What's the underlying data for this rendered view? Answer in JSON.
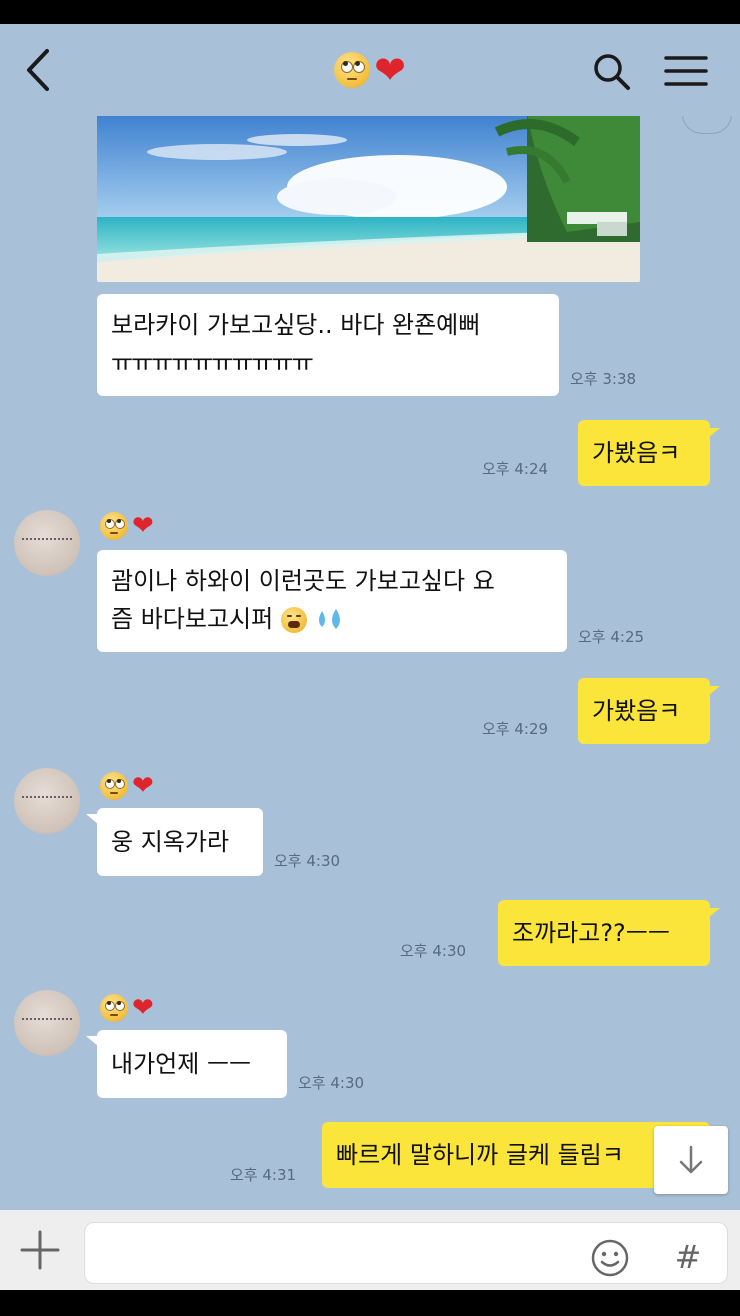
{
  "header": {
    "title_emoji": "eye-roll-face",
    "title_heart": "❤",
    "back_icon": "chevron-left-icon",
    "search_icon": "search-icon",
    "menu_icon": "hamburger-menu-icon"
  },
  "messages": [
    {
      "side": "in",
      "lines": [
        "보라카이 가보고싶당.. 바다 완죤예뻐",
        "ㅠㅠㅠㅠㅠㅠㅠㅠㅠㅠ"
      ],
      "time": "오후 3:38"
    },
    {
      "side": "out",
      "text": "가봤음ㅋ",
      "time": "오후 4:24"
    },
    {
      "side": "in",
      "lines": [
        "괌이나 하와이 이런곳도 가보고싶다 요",
        "즘 바다보고시퍼"
      ],
      "time": "오후 4:25"
    },
    {
      "side": "out",
      "text": "가봤음ㅋ",
      "time": "오후 4:29"
    },
    {
      "side": "in",
      "text": "웅 지옥가라",
      "time": "오후 4:30"
    },
    {
      "side": "out",
      "text": "조까라고??ㅡㅡ",
      "time": "오후 4:30"
    },
    {
      "side": "in",
      "text": "내가언제 ㅡㅡ",
      "time": "오후 4:30"
    },
    {
      "side": "out",
      "text": "빠르게 말하니까 글케 들림ㅋ",
      "time": "오후 4:31"
    }
  ],
  "colors": {
    "chat_background": "#a9c0d9",
    "outgoing_bubble": "#fbe53a",
    "incoming_bubble": "#ffffff"
  },
  "input_bar": {
    "plus_icon": "plus-icon",
    "emoji_icon": "smiley-icon",
    "hash_label": "#"
  },
  "scroll_icon": "arrow-down-icon"
}
